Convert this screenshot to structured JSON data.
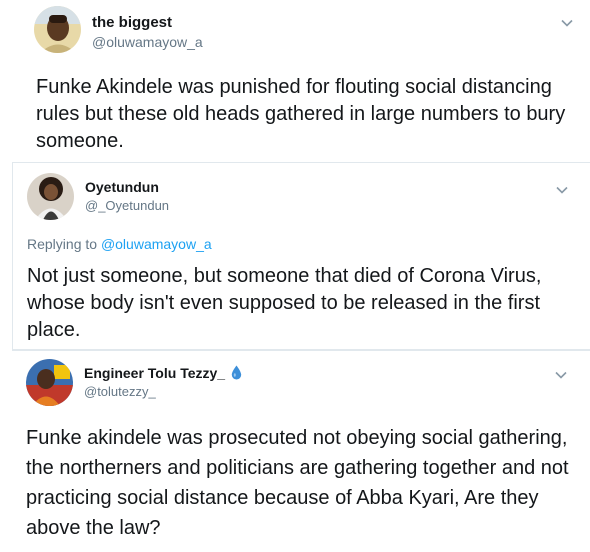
{
  "tweets": [
    {
      "name": "the biggest",
      "handle": "@oluwamayow_a",
      "text": "Funke Akindele was punished for flouting social distancing rules but these old heads gathered in large numbers to bury someone."
    },
    {
      "name": "Oyetundun",
      "handle": "@_Oyetundun",
      "reply_prefix": "Replying to ",
      "reply_to": "@oluwamayow_a",
      "text": "Not just someone, but someone that died of Corona Virus, whose body isn't even supposed to be released in the first place."
    },
    {
      "name": "Engineer Tolu Tezzy_",
      "handle": "@tolutezzy_",
      "name_emoji_icon": "droplet-icon",
      "text": "Funke akindele was prosecuted not obeying social gathering, the northerners and politicians are gathering together and not practicing social distance because of Abba Kyari, Are they above the law?"
    }
  ],
  "colors": {
    "text": "#14171a",
    "secondary": "#657786",
    "link": "#1da1f2",
    "border": "#e1e8ed",
    "droplet": "#3d8fd9"
  },
  "icons": {
    "more": "chevron-down-icon"
  }
}
